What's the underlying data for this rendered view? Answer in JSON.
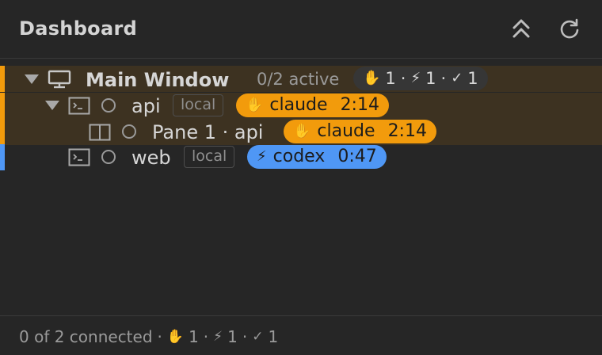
{
  "header": {
    "title": "Dashboard",
    "icons": {
      "collapse_all": "chevrons-up-icon",
      "refresh": "refresh-icon"
    }
  },
  "colors": {
    "waiting": "#f29b0c",
    "running": "#4f97f5",
    "highlight": "#3d3221",
    "background": "#262626"
  },
  "tree": {
    "window": {
      "name": "Main Window",
      "active_summary": "0/2 active",
      "counts": {
        "waiting": "1",
        "running": "1",
        "done": "1"
      },
      "icon": "monitor-icon"
    },
    "sessions": [
      {
        "name": "api",
        "location": "local",
        "agent": {
          "name": "claude",
          "time": "2:14",
          "state": "waiting",
          "icon": "hand-icon"
        },
        "panes": [
          {
            "label": "Pane 1 · api",
            "agent": {
              "name": "claude",
              "time": "2:14",
              "state": "waiting",
              "icon": "hand-icon"
            }
          }
        ]
      },
      {
        "name": "web",
        "location": "local",
        "agent": {
          "name": "codex",
          "time": "0:47",
          "state": "running",
          "icon": "bolt-icon"
        }
      }
    ]
  },
  "footer": {
    "connected": "0 of 2 connected",
    "waiting": "1",
    "running": "1",
    "done": "1"
  },
  "glyphs": {
    "hand": "✋",
    "bolt": "⚡",
    "check": "✓",
    "sep": "·"
  }
}
